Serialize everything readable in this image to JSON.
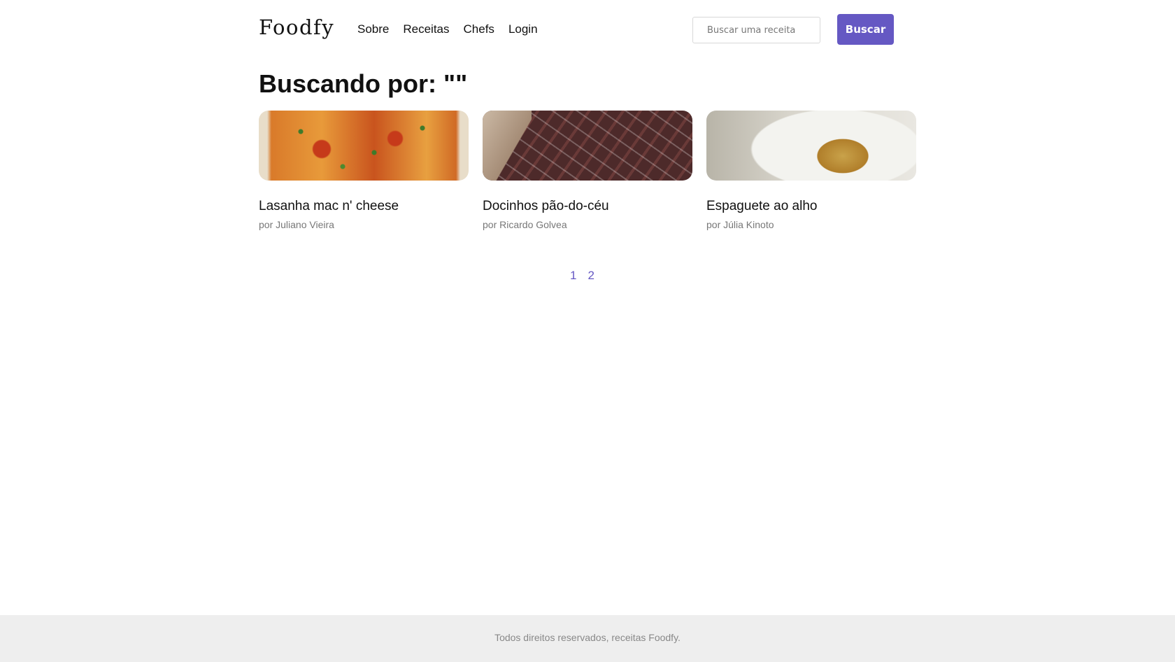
{
  "header": {
    "logo": "Foodfy",
    "nav": [
      "Sobre",
      "Receitas",
      "Chefs",
      "Login"
    ],
    "search_placeholder": "Buscar uma receita",
    "search_value": "",
    "search_button": "Buscar"
  },
  "main": {
    "title": "Buscando por: \"\"",
    "recipes": [
      {
        "title": "Lasanha mac n' cheese",
        "author": "por Juliano Vieira"
      },
      {
        "title": "Docinhos pão-do-céu",
        "author": "por Ricardo Golvea"
      },
      {
        "title": "Espaguete ao alho",
        "author": "por Júlia Kinoto"
      }
    ],
    "pages": [
      "1",
      "2"
    ]
  },
  "footer": {
    "text": "Todos direitos reservados, receitas Foodfy."
  },
  "colors": {
    "accent": "#6558c3",
    "footer_bg": "#eeeeee"
  }
}
